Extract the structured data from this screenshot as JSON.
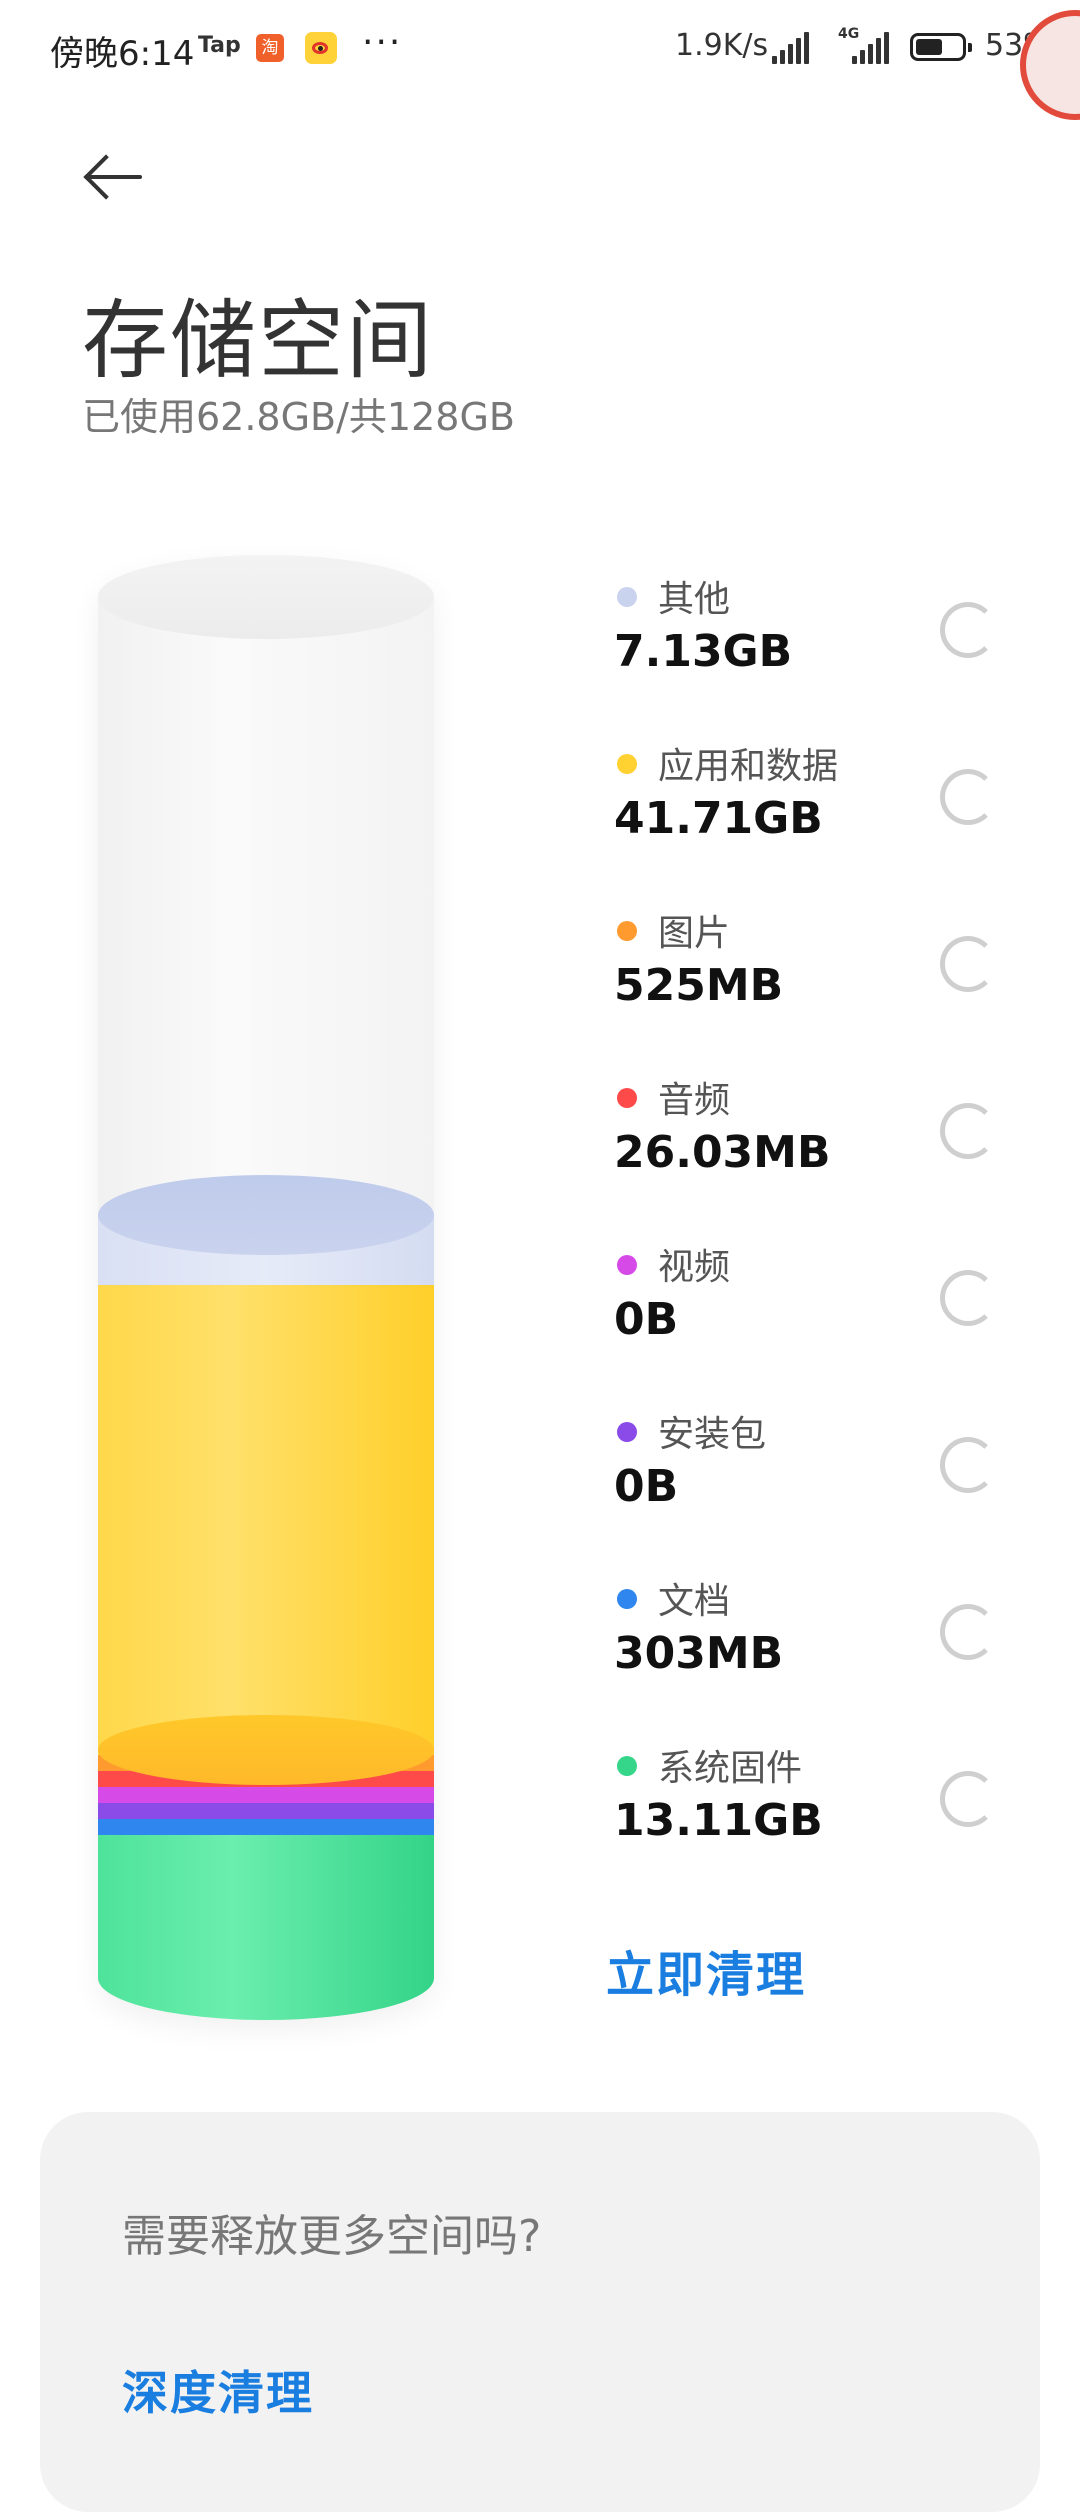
{
  "status_bar": {
    "time": "傍晚6:14",
    "app_label": "Tap",
    "taobao_glyph": "淘",
    "more": "···",
    "net_speed": "1.9K/s",
    "network_type": "4G",
    "battery": "53"
  },
  "header": {
    "title": "存储空间",
    "subtitle": "已使用62.8GB/共128GB"
  },
  "storage": {
    "categories": [
      {
        "label": "其他",
        "size": "7.13GB",
        "color": "#c9d3ee"
      },
      {
        "label": "应用和数据",
        "size": "41.71GB",
        "color": "#ffd232"
      },
      {
        "label": "图片",
        "size": "525MB",
        "color": "#ff9a2e"
      },
      {
        "label": "音频",
        "size": "26.03MB",
        "color": "#ff4a4a"
      },
      {
        "label": "视频",
        "size": "0B",
        "color": "#d64be8"
      },
      {
        "label": "安装包",
        "size": "0B",
        "color": "#8a4be8"
      },
      {
        "label": "文档",
        "size": "303MB",
        "color": "#2f86ee"
      },
      {
        "label": "系统固件",
        "size": "13.11GB",
        "color": "#35d68a"
      }
    ],
    "clean_button": "立即清理"
  },
  "card": {
    "question": "需要释放更多空间吗?",
    "deep_clean": "深度清理"
  },
  "icons": {
    "back": "arrow-left-icon",
    "spinner": "loading-spinner-icon"
  }
}
